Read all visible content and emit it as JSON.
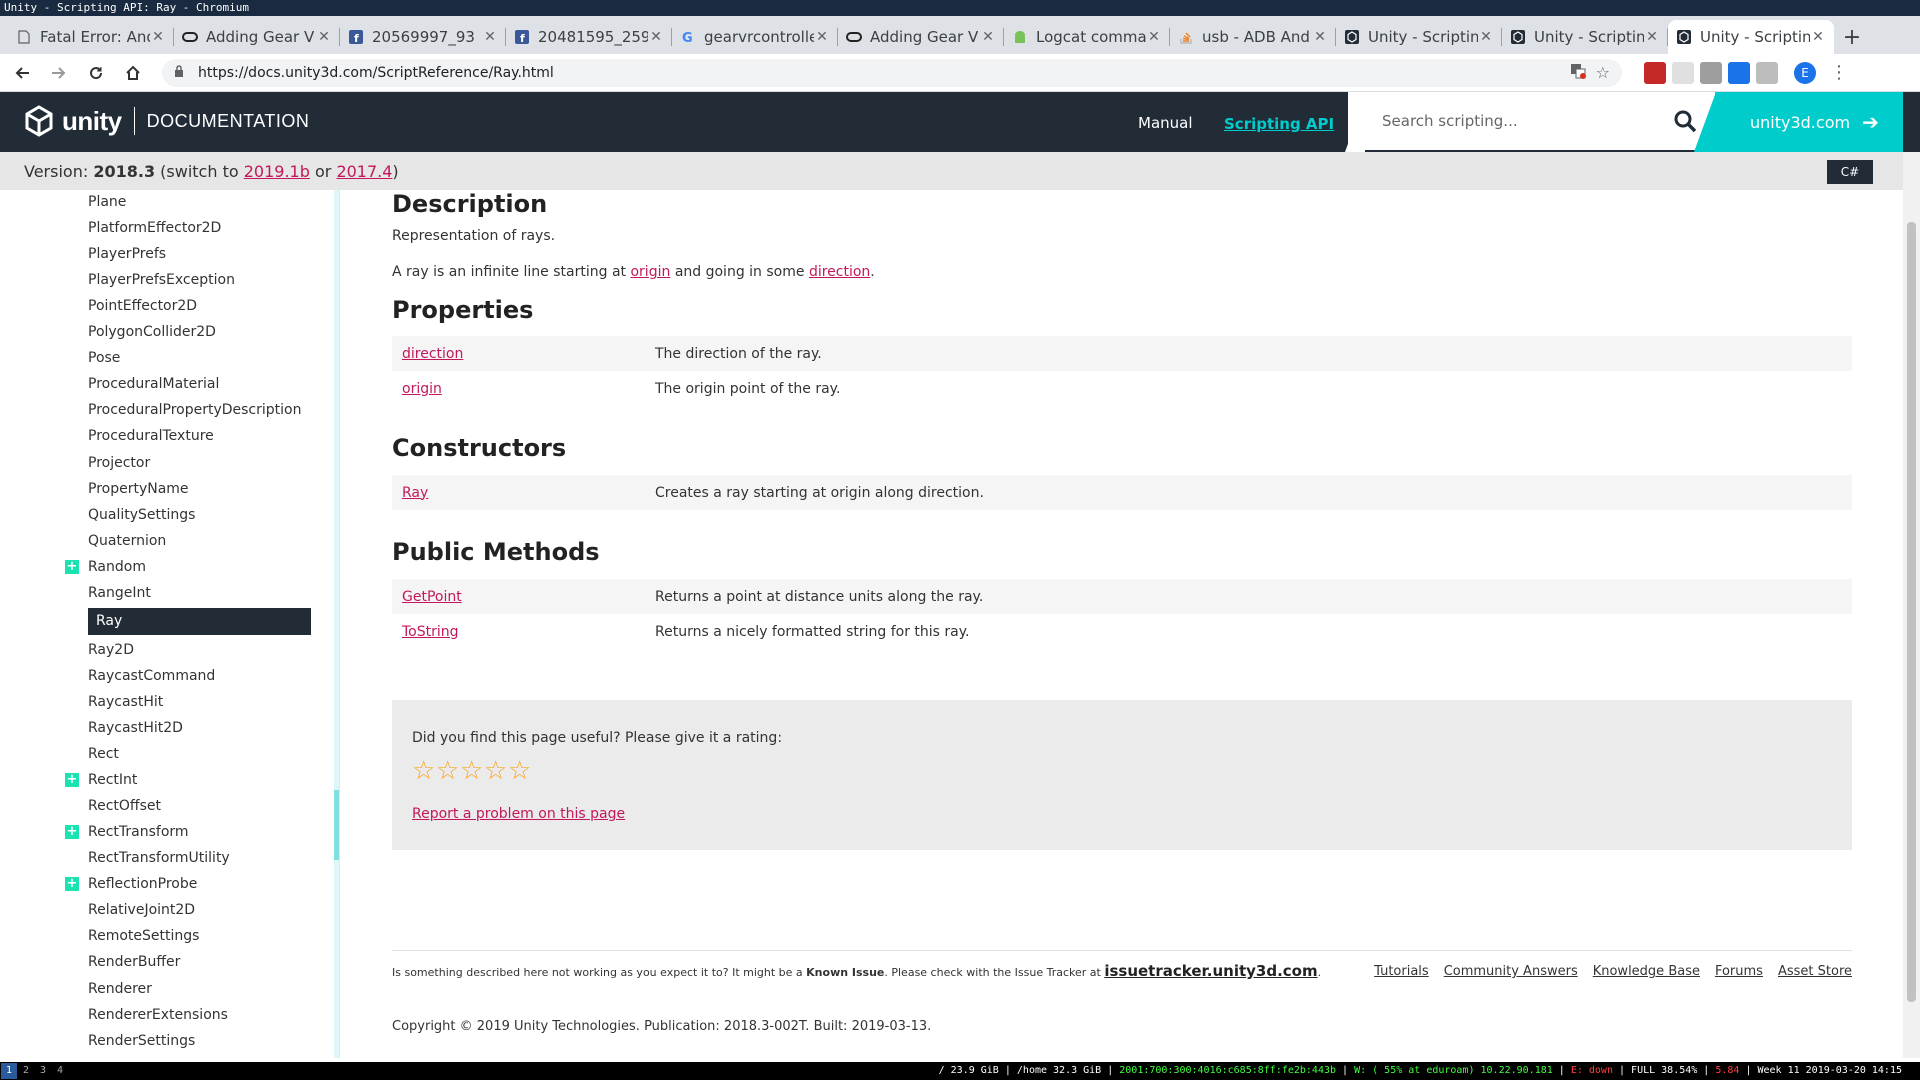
{
  "window_title": "Unity - Scripting API: Ray - Chromium",
  "tabs": [
    {
      "title": "Fatal Error: And",
      "icon": "page-icon"
    },
    {
      "title": "Adding Gear V",
      "icon": "oculus-icon"
    },
    {
      "title": "20569997_93",
      "icon": "facebook-icon"
    },
    {
      "title": "20481595_259",
      "icon": "facebook-icon"
    },
    {
      "title": "gearvrcontrolle",
      "icon": "google-icon"
    },
    {
      "title": "Adding Gear V",
      "icon": "oculus-icon"
    },
    {
      "title": "Logcat comman",
      "icon": "android-icon"
    },
    {
      "title": "usb - ADB And",
      "icon": "stackoverflow-icon"
    },
    {
      "title": "Unity - Scriptin",
      "icon": "unity-icon"
    },
    {
      "title": "Unity - Scriptin",
      "icon": "unity-icon"
    },
    {
      "title": "Unity - Scriptin",
      "icon": "unity-icon"
    }
  ],
  "address_bar": {
    "url": "https://docs.unity3d.com/ScriptReference/Ray.html"
  },
  "header": {
    "brand": "unity",
    "section": "DOCUMENTATION",
    "nav_manual": "Manual",
    "nav_api": "Scripting API",
    "search_placeholder": "Search scripting...",
    "site_link": "unity3d.com",
    "accent": "#00cccc"
  },
  "version": {
    "label": "Version:",
    "current": "2018.3",
    "switch_text": "(switch to",
    "alt1": "2019.1b",
    "or": "or",
    "alt2": "2017.4",
    "close": ")",
    "lang": "C#"
  },
  "sidebar": {
    "items": [
      {
        "label": "Plane",
        "plus": false
      },
      {
        "label": "PlatformEffector2D",
        "plus": false
      },
      {
        "label": "PlayerPrefs",
        "plus": false
      },
      {
        "label": "PlayerPrefsException",
        "plus": false
      },
      {
        "label": "PointEffector2D",
        "plus": false
      },
      {
        "label": "PolygonCollider2D",
        "plus": false
      },
      {
        "label": "Pose",
        "plus": false
      },
      {
        "label": "ProceduralMaterial",
        "plus": false
      },
      {
        "label": "ProceduralPropertyDescription",
        "plus": false
      },
      {
        "label": "ProceduralTexture",
        "plus": false
      },
      {
        "label": "Projector",
        "plus": false
      },
      {
        "label": "PropertyName",
        "plus": false
      },
      {
        "label": "QualitySettings",
        "plus": false
      },
      {
        "label": "Quaternion",
        "plus": false
      },
      {
        "label": "Random",
        "plus": true
      },
      {
        "label": "RangeInt",
        "plus": false
      },
      {
        "label": "Ray",
        "plus": false,
        "active": true
      },
      {
        "label": "Ray2D",
        "plus": false
      },
      {
        "label": "RaycastCommand",
        "plus": false
      },
      {
        "label": "RaycastHit",
        "plus": false
      },
      {
        "label": "RaycastHit2D",
        "plus": false
      },
      {
        "label": "Rect",
        "plus": false
      },
      {
        "label": "RectInt",
        "plus": true
      },
      {
        "label": "RectOffset",
        "plus": false
      },
      {
        "label": "RectTransform",
        "plus": true
      },
      {
        "label": "RectTransformUtility",
        "plus": false
      },
      {
        "label": "ReflectionProbe",
        "plus": true
      },
      {
        "label": "RelativeJoint2D",
        "plus": false
      },
      {
        "label": "RemoteSettings",
        "plus": false
      },
      {
        "label": "RenderBuffer",
        "plus": false
      },
      {
        "label": "Renderer",
        "plus": false
      },
      {
        "label": "RendererExtensions",
        "plus": false
      },
      {
        "label": "RenderSettings",
        "plus": false
      }
    ]
  },
  "content": {
    "description_heading": "Description",
    "description_short": "Representation of rays.",
    "description_long_1": "A ray is an infinite line starting at",
    "description_link_origin": "origin",
    "description_long_2": "and going in some",
    "description_link_direction": "direction",
    "description_long_3": ".",
    "properties_heading": "Properties",
    "properties": [
      {
        "name": "direction",
        "desc": "The direction of the ray."
      },
      {
        "name": "origin",
        "desc": "The origin point of the ray."
      }
    ],
    "constructors_heading": "Constructors",
    "constructors": [
      {
        "name": "Ray",
        "desc": "Creates a ray starting at origin along direction."
      }
    ],
    "methods_heading": "Public Methods",
    "methods": [
      {
        "name": "GetPoint",
        "desc": "Returns a point at distance units along the ray."
      },
      {
        "name": "ToString",
        "desc": "Returns a nicely formatted string for this ray."
      }
    ]
  },
  "rating": {
    "question": "Did you find this page useful? Please give it a rating:",
    "stars": 5,
    "report": "Report a problem on this page"
  },
  "footer": {
    "issue_1": "Is something described here not working as you expect it to? It might be a",
    "issue_bold": "Known Issue",
    "issue_2": ". Please check with the Issue Tracker at",
    "issue_link": "issuetracker.unity3d.com",
    "issue_3": ".",
    "links": [
      "Tutorials",
      "Community Answers",
      "Knowledge Base",
      "Forums",
      "Asset Store"
    ],
    "copyright": "Copyright © 2019 Unity Technologies. Publication: 2018.3-002T. Built: 2019-03-13."
  },
  "statusbar": {
    "workspaces": [
      "1",
      "2",
      "3",
      "4"
    ],
    "disk_root": "/ 23.9 GiB",
    "disk_home": "/home 32.3 GiB",
    "ipv6": "2001:700:300:4016:c685:8ff:fe2b:443b",
    "wifi": "W: ( 55% at eduroam) 10.22.90.181",
    "eth": "E: down",
    "battery": "FULL 38.54%",
    "load": "5.84",
    "datetime": "Week 11 2019-03-20 14:15"
  }
}
